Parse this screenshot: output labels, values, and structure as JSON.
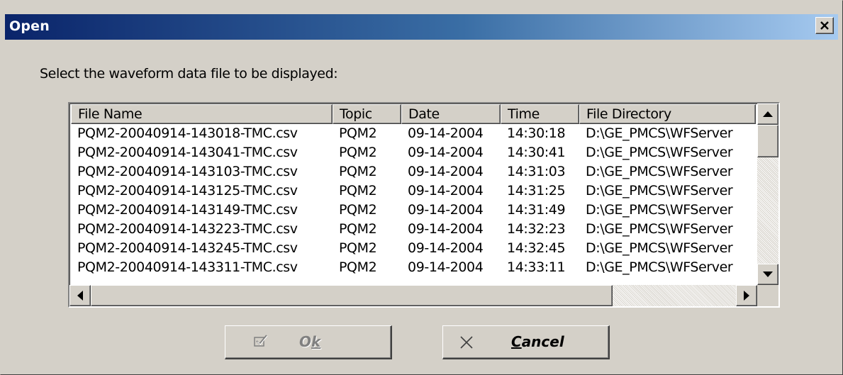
{
  "window": {
    "title": "Open",
    "close_glyph": "✕"
  },
  "prompt": "Select the waveform data file to be displayed:",
  "columns": [
    "File Name",
    "Topic",
    "Date",
    "Time",
    "File Directory"
  ],
  "rows": [
    [
      "PQM2-20040914-143018-TMC.csv",
      "PQM2",
      "09-14-2004",
      "14:30:18",
      "D:\\GE_PMCS\\WFServer"
    ],
    [
      "PQM2-20040914-143041-TMC.csv",
      "PQM2",
      "09-14-2004",
      "14:30:41",
      "D:\\GE_PMCS\\WFServer"
    ],
    [
      "PQM2-20040914-143103-TMC.csv",
      "PQM2",
      "09-14-2004",
      "14:31:03",
      "D:\\GE_PMCS\\WFServer"
    ],
    [
      "PQM2-20040914-143125-TMC.csv",
      "PQM2",
      "09-14-2004",
      "14:31:25",
      "D:\\GE_PMCS\\WFServer"
    ],
    [
      "PQM2-20040914-143149-TMC.csv",
      "PQM2",
      "09-14-2004",
      "14:31:49",
      "D:\\GE_PMCS\\WFServer"
    ],
    [
      "PQM2-20040914-143223-TMC.csv",
      "PQM2",
      "09-14-2004",
      "14:32:23",
      "D:\\GE_PMCS\\WFServer"
    ],
    [
      "PQM2-20040914-143245-TMC.csv",
      "PQM2",
      "09-14-2004",
      "14:32:45",
      "D:\\GE_PMCS\\WFServer"
    ],
    [
      "PQM2-20040914-143311-TMC.csv",
      "PQM2",
      "09-14-2004",
      "14:33:11",
      "D:\\GE_PMCS\\WFServer"
    ]
  ],
  "buttons": {
    "ok": {
      "label_pre": "O",
      "label_underlined": "k",
      "enabled": false,
      "icon": "checkmark-icon"
    },
    "cancel": {
      "label_underlined": "C",
      "label_post": "ancel",
      "enabled": true,
      "icon": "close-icon"
    }
  },
  "colors": {
    "titlebar_start": "#0a246a",
    "titlebar_end": "#a6caf0",
    "face": "#d4d0c8"
  }
}
